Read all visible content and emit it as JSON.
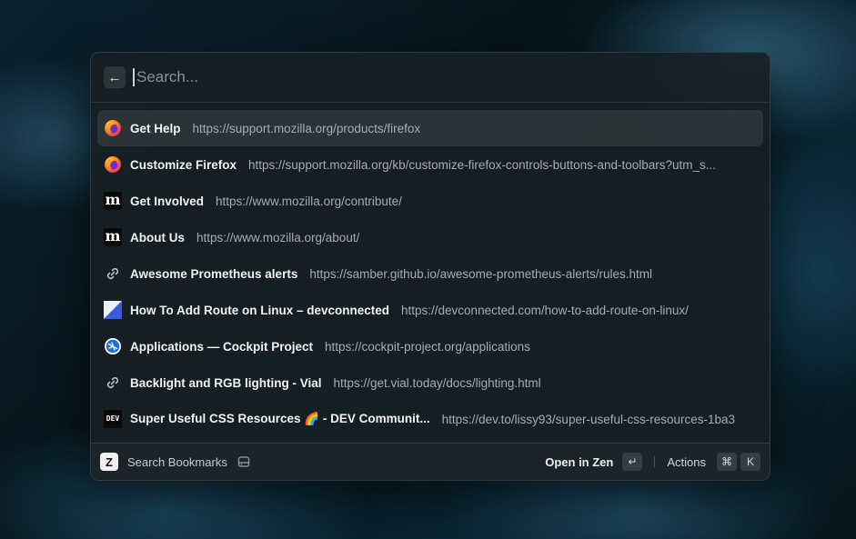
{
  "search": {
    "placeholder": "Search...",
    "value": ""
  },
  "results": [
    {
      "icon": "firefox-icon",
      "title": "Get Help",
      "url": "https://support.mozilla.org/products/firefox",
      "selected": true
    },
    {
      "icon": "firefox-icon",
      "title": "Customize Firefox",
      "url": "https://support.mozilla.org/kb/customize-firefox-controls-buttons-and-toolbars?utm_s..."
    },
    {
      "icon": "mozilla-icon",
      "title": "Get Involved",
      "url": "https://www.mozilla.org/contribute/"
    },
    {
      "icon": "mozilla-icon",
      "title": "About Us",
      "url": "https://www.mozilla.org/about/"
    },
    {
      "icon": "link-icon",
      "title": "Awesome Prometheus alerts",
      "url": "https://samber.github.io/awesome-prometheus-alerts/rules.html"
    },
    {
      "icon": "devconnected-icon",
      "title": "How To Add Route on Linux – devconnected",
      "url": "https://devconnected.com/how-to-add-route-on-linux/"
    },
    {
      "icon": "cockpit-icon",
      "title": "Applications — Cockpit Project",
      "url": "https://cockpit-project.org/applications"
    },
    {
      "icon": "link-icon",
      "title": "Backlight and RGB lighting - Vial",
      "url": "https://get.vial.today/docs/lighting.html"
    },
    {
      "icon": "dev-icon",
      "title": "Super Useful CSS Resources 🌈 - DEV Communit...",
      "url": "https://dev.to/lissy93/super-useful-css-resources-1ba3"
    }
  ],
  "footer": {
    "logo_text": "Z",
    "context_label": "Search Bookmarks",
    "primary_action": "Open in Zen",
    "enter_key": "↵",
    "actions_label": "Actions",
    "cmd_key": "⌘",
    "k_key": "K"
  },
  "mozilla_logo_text": "m",
  "dev_logo_text": "DEV",
  "back_icon_glyph": "←"
}
